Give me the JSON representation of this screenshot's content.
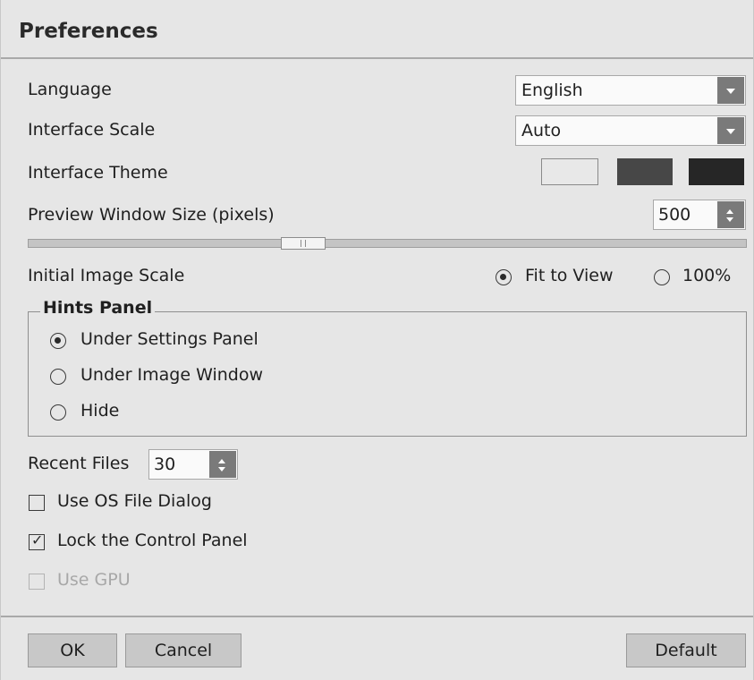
{
  "dialog": {
    "title": "Preferences"
  },
  "language": {
    "label": "Language",
    "value": "English"
  },
  "interface_scale": {
    "label": "Interface Scale",
    "value": "Auto"
  },
  "interface_theme": {
    "label": "Interface Theme",
    "options": [
      {
        "name": "light",
        "color": "#e8e8e8",
        "selected": true
      },
      {
        "name": "medium",
        "color": "#474747",
        "selected": false
      },
      {
        "name": "dark",
        "color": "#262626",
        "selected": false
      }
    ]
  },
  "preview_window_size": {
    "label": "Preview Window Size (pixels)",
    "value": "500",
    "slider_fraction": 0.4
  },
  "initial_image_scale": {
    "label": "Initial Image Scale",
    "options": [
      {
        "label": "Fit to View",
        "selected": true
      },
      {
        "label": "100%",
        "selected": false
      }
    ]
  },
  "hints_panel": {
    "title": "Hints Panel",
    "options": [
      {
        "label": "Under Settings Panel",
        "selected": true
      },
      {
        "label": "Under Image Window",
        "selected": false
      },
      {
        "label": "Hide",
        "selected": false
      }
    ]
  },
  "recent_files": {
    "label": "Recent Files",
    "value": "30"
  },
  "checkboxes": {
    "use_os_file_dialog": {
      "label": "Use OS File Dialog",
      "checked": false,
      "enabled": true
    },
    "lock_control_panel": {
      "label": "Lock the Control Panel",
      "checked": true,
      "enabled": true
    },
    "use_gpu": {
      "label": "Use GPU",
      "checked": false,
      "enabled": false
    }
  },
  "buttons": {
    "ok": "OK",
    "cancel": "Cancel",
    "default": "Default"
  }
}
